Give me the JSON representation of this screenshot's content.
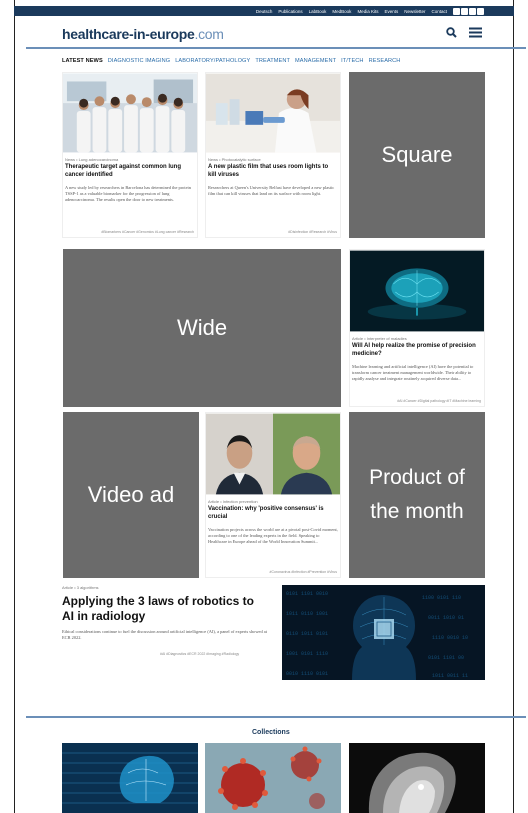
{
  "topbar": {
    "links": [
      "Deutsch",
      "Publications",
      "LabBook",
      "MedBook",
      "Media Kits",
      "Events",
      "Newsletter",
      "Contact"
    ],
    "social_icons": [
      "facebook-icon",
      "twitter-icon",
      "linkedin-icon",
      "youtube-icon"
    ]
  },
  "header": {
    "logo_main": "healthcare-in-europe",
    "logo_suffix": ".com",
    "icons": [
      "search-icon",
      "menu-icon"
    ]
  },
  "nav": {
    "items": [
      "LATEST NEWS",
      "DIAGNOSTIC IMAGING",
      "LABORATORY/PATHOLOGY",
      "TREATMENT",
      "MANAGEMENT",
      "IT/TECH",
      "RESEARCH"
    ]
  },
  "cards": [
    {
      "meta": "News • Lung adenocarcinoma",
      "title": "Therapeutic target against common lung cancer identified",
      "text": "A new study led by researchers in Barcelona has determined the protein TSSP-1 as a valuable biomarker for the progression of lung adenocarcinoma. The results open the door to new treatments.",
      "tags": "#Biomarkers  #Cancer  #Genomics  #Lung cancer  #Research"
    },
    {
      "meta": "News • Photocatalytic surface",
      "title": "A new plastic film that uses room lights to kill viruses",
      "text": "Researchers at Queen's University Belfast have developed a new plastic film that can kill viruses that land on its surface with room light.",
      "tags": "#Disinfection  #Research  #Virus"
    },
    {
      "meta": "Article • Interpreter of maladies",
      "title": "Will AI help realize the promise of precision medicine?",
      "text": "Machine learning and artificial intelligence (AI) have the potential to transform cancer treatment management worldwide. Their ability to rapidly analyse and integrate routinely acquired diverse data...",
      "tags": "#AI  #Cancer  #Digital pathology  #IT  #Machine learning"
    },
    {
      "meta": "Article • Infection prevention",
      "title": "Vaccination: why 'positive consensus' is crucial",
      "text": "Vaccination projects across the world are at a pivotal post-Covid moment, according to one of the leading experts in the field. Speaking to Healthcare in Europe ahead of the World Innovation Summit...",
      "tags": "#Coronavirus  #Infection  #Prevention  #Virus"
    }
  ],
  "ads": {
    "square": "Square",
    "wide": "Wide",
    "video": "Video ad",
    "product": "Product of the month"
  },
  "feature": {
    "meta": "Article • 3 algorithms",
    "title": "Applying the 3 laws of robotics to AI in radiology",
    "text": "Ethical considerations continue to fuel the discussion around artificial intelligence (AI), a panel of experts showed at ECR 2022.",
    "tags": "#AI  #Diagnostics  #ECR 2022  #Imaging  #Radiology"
  },
  "collections": {
    "title": "Collections"
  }
}
